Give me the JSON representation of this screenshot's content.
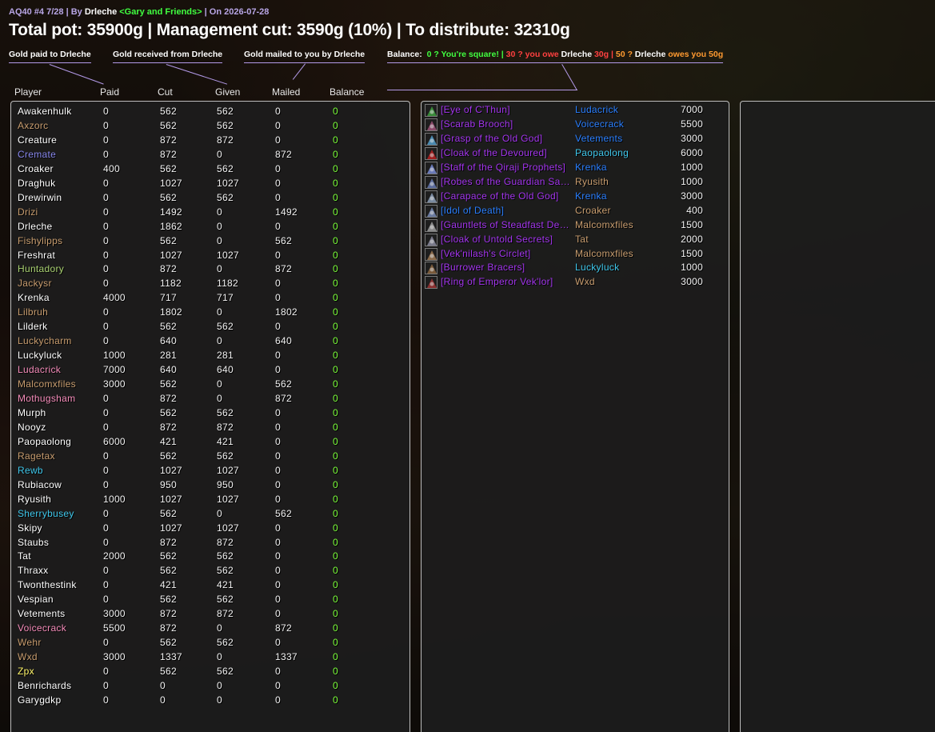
{
  "header": {
    "raid": "AQ40 #4 7/28",
    "by_label": "| By",
    "leader": "Drleche",
    "guild": "<Gary and Friends>",
    "date_label": "| On 2026-07-28",
    "pot": "Total pot: 35900g | Management cut: 3590g (10%) | To distribute: 32310g"
  },
  "legend": {
    "paid": "Gold paid to Drleche",
    "received": "Gold received from Drleche",
    "mailed": "Gold mailed to you by Drleche",
    "balance_label": "Balance:",
    "square": "0 ? You're square!",
    "sep1": "|",
    "owe_a": "30 ? you owe",
    "owe_name": "Drleche",
    "owe_b": "30g",
    "sep2": "|",
    "owes_a": "50 ?",
    "owes_name": "Drleche",
    "owes_b": "owes you 50g"
  },
  "columns": {
    "player": "Player",
    "paid": "Paid",
    "cut": "Cut",
    "given": "Given",
    "mailed": "Mailed",
    "balance": "Balance"
  },
  "colors": {
    "warrior": "#c79c6e",
    "priest": "#ffffff",
    "mage": "#3fc7eb",
    "warlock": "#8787ed",
    "druid": "#ff7d0a",
    "paladin": "#f58cba",
    "rogue": "#fff569",
    "hunter": "#a9d271",
    "shaman": "#0070de",
    "epic": "#a335ee",
    "balance": "#7cff3a"
  },
  "players": [
    {
      "name": "Awakenhulk",
      "color": "#ffffff",
      "paid": "0",
      "cut": "562",
      "given": "562",
      "mailed": "0",
      "balance": "0"
    },
    {
      "name": "Axzorc",
      "color": "#c79c6e",
      "paid": "0",
      "cut": "562",
      "given": "562",
      "mailed": "0",
      "balance": "0"
    },
    {
      "name": "Creature",
      "color": "#ffffff",
      "paid": "0",
      "cut": "872",
      "given": "872",
      "mailed": "0",
      "balance": "0"
    },
    {
      "name": "Cremate",
      "color": "#8787ed",
      "paid": "0",
      "cut": "872",
      "given": "0",
      "mailed": "872",
      "balance": "0"
    },
    {
      "name": "Croaker",
      "color": "#ffffff",
      "paid": "400",
      "cut": "562",
      "given": "562",
      "mailed": "0",
      "balance": "0"
    },
    {
      "name": "Draghuk",
      "color": "#ffffff",
      "paid": "0",
      "cut": "1027",
      "given": "1027",
      "mailed": "0",
      "balance": "0"
    },
    {
      "name": "Drewirwin",
      "color": "#ffffff",
      "paid": "0",
      "cut": "562",
      "given": "562",
      "mailed": "0",
      "balance": "0"
    },
    {
      "name": "Drizi",
      "color": "#c79c6e",
      "paid": "0",
      "cut": "1492",
      "given": "0",
      "mailed": "1492",
      "balance": "0"
    },
    {
      "name": "Drleche",
      "color": "#ffffff",
      "paid": "0",
      "cut": "1862",
      "given": "0",
      "mailed": "0",
      "balance": "0"
    },
    {
      "name": "Fishylipps",
      "color": "#c79c6e",
      "paid": "0",
      "cut": "562",
      "given": "0",
      "mailed": "562",
      "balance": "0"
    },
    {
      "name": "Freshrat",
      "color": "#ffffff",
      "paid": "0",
      "cut": "1027",
      "given": "1027",
      "mailed": "0",
      "balance": "0"
    },
    {
      "name": "Huntadory",
      "color": "#a9d271",
      "paid": "0",
      "cut": "872",
      "given": "0",
      "mailed": "872",
      "balance": "0"
    },
    {
      "name": "Jackysr",
      "color": "#c79c6e",
      "paid": "0",
      "cut": "1182",
      "given": "1182",
      "mailed": "0",
      "balance": "0"
    },
    {
      "name": "Krenka",
      "color": "#ffffff",
      "paid": "4000",
      "cut": "717",
      "given": "717",
      "mailed": "0",
      "balance": "0"
    },
    {
      "name": "Lilbruh",
      "color": "#c79c6e",
      "paid": "0",
      "cut": "1802",
      "given": "0",
      "mailed": "1802",
      "balance": "0"
    },
    {
      "name": "Lilderk",
      "color": "#ffffff",
      "paid": "0",
      "cut": "562",
      "given": "562",
      "mailed": "0",
      "balance": "0"
    },
    {
      "name": "Luckycharm",
      "color": "#c79c6e",
      "paid": "0",
      "cut": "640",
      "given": "0",
      "mailed": "640",
      "balance": "0"
    },
    {
      "name": "Luckyluck",
      "color": "#ffffff",
      "paid": "1000",
      "cut": "281",
      "given": "281",
      "mailed": "0",
      "balance": "0"
    },
    {
      "name": "Ludacrick",
      "color": "#f58cba",
      "paid": "7000",
      "cut": "640",
      "given": "640",
      "mailed": "0",
      "balance": "0"
    },
    {
      "name": "Malcomxfiles",
      "color": "#c79c6e",
      "paid": "3000",
      "cut": "562",
      "given": "0",
      "mailed": "562",
      "balance": "0"
    },
    {
      "name": "Mothugsham",
      "color": "#f58cba",
      "paid": "0",
      "cut": "872",
      "given": "0",
      "mailed": "872",
      "balance": "0"
    },
    {
      "name": "Murph",
      "color": "#ffffff",
      "paid": "0",
      "cut": "562",
      "given": "562",
      "mailed": "0",
      "balance": "0"
    },
    {
      "name": "Nooyz",
      "color": "#ffffff",
      "paid": "0",
      "cut": "872",
      "given": "872",
      "mailed": "0",
      "balance": "0"
    },
    {
      "name": "Paopaolong",
      "color": "#ffffff",
      "paid": "6000",
      "cut": "421",
      "given": "421",
      "mailed": "0",
      "balance": "0"
    },
    {
      "name": "Ragetax",
      "color": "#c79c6e",
      "paid": "0",
      "cut": "562",
      "given": "562",
      "mailed": "0",
      "balance": "0"
    },
    {
      "name": "Rewb",
      "color": "#3fc7eb",
      "paid": "0",
      "cut": "1027",
      "given": "1027",
      "mailed": "0",
      "balance": "0"
    },
    {
      "name": "Rubiacow",
      "color": "#ffffff",
      "paid": "0",
      "cut": "950",
      "given": "950",
      "mailed": "0",
      "balance": "0"
    },
    {
      "name": "Ryusith",
      "color": "#ffffff",
      "paid": "1000",
      "cut": "1027",
      "given": "1027",
      "mailed": "0",
      "balance": "0"
    },
    {
      "name": "Sherrybusey",
      "color": "#3fc7eb",
      "paid": "0",
      "cut": "562",
      "given": "0",
      "mailed": "562",
      "balance": "0"
    },
    {
      "name": "Skipy",
      "color": "#ffffff",
      "paid": "0",
      "cut": "1027",
      "given": "1027",
      "mailed": "0",
      "balance": "0"
    },
    {
      "name": "Staubs",
      "color": "#ffffff",
      "paid": "0",
      "cut": "872",
      "given": "872",
      "mailed": "0",
      "balance": "0"
    },
    {
      "name": "Tat",
      "color": "#ffffff",
      "paid": "2000",
      "cut": "562",
      "given": "562",
      "mailed": "0",
      "balance": "0"
    },
    {
      "name": "Thraxx",
      "color": "#ffffff",
      "paid": "0",
      "cut": "562",
      "given": "562",
      "mailed": "0",
      "balance": "0"
    },
    {
      "name": "Twonthestink",
      "color": "#ffffff",
      "paid": "0",
      "cut": "421",
      "given": "421",
      "mailed": "0",
      "balance": "0"
    },
    {
      "name": "Vespian",
      "color": "#ffffff",
      "paid": "0",
      "cut": "562",
      "given": "562",
      "mailed": "0",
      "balance": "0"
    },
    {
      "name": "Vetements",
      "color": "#ffffff",
      "paid": "3000",
      "cut": "872",
      "given": "872",
      "mailed": "0",
      "balance": "0"
    },
    {
      "name": "Voicecrack",
      "color": "#f58cba",
      "paid": "5500",
      "cut": "872",
      "given": "0",
      "mailed": "872",
      "balance": "0"
    },
    {
      "name": "Wehr",
      "color": "#c79c6e",
      "paid": "0",
      "cut": "562",
      "given": "562",
      "mailed": "0",
      "balance": "0"
    },
    {
      "name": "Wxd",
      "color": "#c79c6e",
      "paid": "3000",
      "cut": "1337",
      "given": "0",
      "mailed": "1337",
      "balance": "0"
    },
    {
      "name": "Zpx",
      "color": "#fff569",
      "paid": "0",
      "cut": "562",
      "given": "562",
      "mailed": "0",
      "balance": "0"
    },
    {
      "name": "Benrichards",
      "color": "#ffffff",
      "paid": "0",
      "cut": "0",
      "given": "0",
      "mailed": "0",
      "balance": "0"
    },
    {
      "name": "Garygdkp",
      "color": "#ffffff",
      "paid": "0",
      "cut": "0",
      "given": "0",
      "mailed": "0",
      "balance": "0"
    }
  ],
  "loot": [
    {
      "item": "[Eye of C'Thun]",
      "icon": "eye-icon",
      "icon_color": "#3a8a3a",
      "winner": "Ludacrick",
      "winner_color": "#2a7fff",
      "amount": "7000"
    },
    {
      "item": "[Scarab Brooch]",
      "icon": "brooch-icon",
      "icon_color": "#8a4a6a",
      "winner": "Voicecrack",
      "winner_color": "#2a7fff",
      "amount": "5500"
    },
    {
      "item": "[Grasp of the Old God]",
      "icon": "grasp-icon",
      "icon_color": "#4a8ab0",
      "winner": "Vetements",
      "winner_color": "#2a7fff",
      "amount": "3000"
    },
    {
      "item": "[Cloak of the Devoured]",
      "icon": "cloak-icon",
      "icon_color": "#a02020",
      "winner": "Paopaolong",
      "winner_color": "#3fc7eb",
      "amount": "6000"
    },
    {
      "item": "[Staff of the Qiraji Prophets]",
      "icon": "staff-icon",
      "icon_color": "#6a7ab8",
      "winner": "Krenka",
      "winner_color": "#2a7fff",
      "amount": "1000"
    },
    {
      "item": "[Robes of the Guardian Saint]",
      "icon": "robe-icon",
      "icon_color": "#5a6a9a",
      "winner": "Ryusith",
      "winner_color": "#c79c6e",
      "amount": "1000"
    },
    {
      "item": "[Carapace of the Old God]",
      "icon": "carapace-icon",
      "icon_color": "#7a8aa0",
      "winner": "Krenka",
      "winner_color": "#2a7fff",
      "amount": "3000"
    },
    {
      "item": "[Idol of Death]",
      "icon": "idol-icon",
      "icon_color": "#6a7aa0",
      "item_color": "#2a7fff",
      "winner": "Croaker",
      "winner_color": "#c79c6e",
      "amount": "400"
    },
    {
      "item": "[Gauntlets of Steadfast Determination]",
      "icon": "gauntlets-icon",
      "icon_color": "#8a8a8a",
      "winner": "Malcomxfiles",
      "winner_color": "#c79c6e",
      "amount": "1500"
    },
    {
      "item": "[Cloak of Untold Secrets]",
      "icon": "cloak-icon",
      "icon_color": "#7a7a8a",
      "winner": "Tat",
      "winner_color": "#c79c6e",
      "amount": "2000"
    },
    {
      "item": "[Vek'nilash's Circlet]",
      "icon": "circlet-icon",
      "icon_color": "#8a6a4a",
      "winner": "Malcomxfiles",
      "winner_color": "#c79c6e",
      "amount": "1500"
    },
    {
      "item": "[Burrower Bracers]",
      "icon": "bracers-icon",
      "icon_color": "#7a5a3a",
      "winner": "Luckyluck",
      "winner_color": "#3fc7eb",
      "amount": "1000"
    },
    {
      "item": "[Ring of Emperor Vek'lor]",
      "icon": "ring-icon",
      "icon_color": "#8a3030",
      "winner": "Wxd",
      "winner_color": "#c79c6e",
      "amount": "3000"
    }
  ]
}
